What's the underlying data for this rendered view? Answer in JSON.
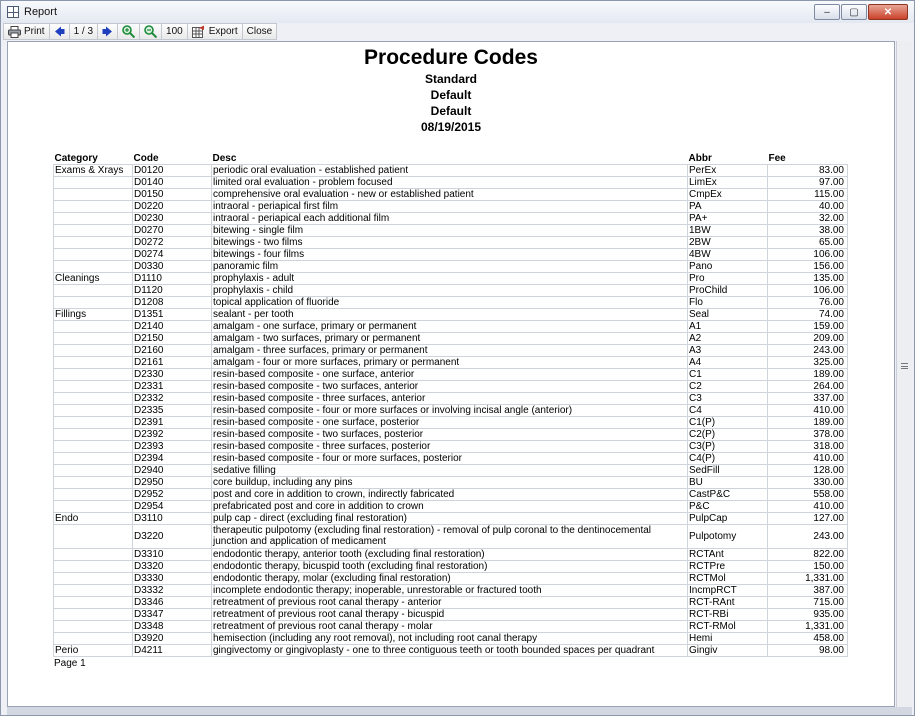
{
  "window": {
    "title": "Report",
    "min_glyph": "–",
    "max_glyph": "▢",
    "close_glyph": "✕"
  },
  "toolbar": {
    "print_label": "Print",
    "page_indicator": "1 / 3",
    "zoom_value": "100",
    "export_label": "Export",
    "close_label": "Close"
  },
  "report": {
    "title": "Procedure Codes",
    "subtitles": [
      "Standard",
      "Default",
      "Default",
      "08/19/2015"
    ],
    "columns": {
      "category": "Category",
      "code": "Code",
      "desc": "Desc",
      "abbr": "Abbr",
      "fee": "Fee"
    },
    "rows": [
      {
        "category": "Exams & Xrays",
        "code": "D0120",
        "desc": "periodic oral evaluation - established patient",
        "abbr": "PerEx",
        "fee": "83.00"
      },
      {
        "category": "",
        "code": "D0140",
        "desc": "limited oral evaluation - problem focused",
        "abbr": "LimEx",
        "fee": "97.00"
      },
      {
        "category": "",
        "code": "D0150",
        "desc": "comprehensive oral evaluation - new or established patient",
        "abbr": "CmpEx",
        "fee": "115.00"
      },
      {
        "category": "",
        "code": "D0220",
        "desc": "intraoral - periapical first film",
        "abbr": "PA",
        "fee": "40.00"
      },
      {
        "category": "",
        "code": "D0230",
        "desc": "intraoral - periapical each additional film",
        "abbr": "PA+",
        "fee": "32.00"
      },
      {
        "category": "",
        "code": "D0270",
        "desc": "bitewing - single film",
        "abbr": "1BW",
        "fee": "38.00"
      },
      {
        "category": "",
        "code": "D0272",
        "desc": "bitewings - two films",
        "abbr": "2BW",
        "fee": "65.00"
      },
      {
        "category": "",
        "code": "D0274",
        "desc": "bitewings - four films",
        "abbr": "4BW",
        "fee": "106.00"
      },
      {
        "category": "",
        "code": "D0330",
        "desc": "panoramic film",
        "abbr": "Pano",
        "fee": "156.00"
      },
      {
        "category": "Cleanings",
        "code": "D1110",
        "desc": "prophylaxis - adult",
        "abbr": "Pro",
        "fee": "135.00"
      },
      {
        "category": "",
        "code": "D1120",
        "desc": "prophylaxis - child",
        "abbr": "ProChild",
        "fee": "106.00"
      },
      {
        "category": "",
        "code": "D1208",
        "desc": "topical application of fluoride",
        "abbr": "Flo",
        "fee": "76.00"
      },
      {
        "category": "Fillings",
        "code": "D1351",
        "desc": "sealant - per tooth",
        "abbr": "Seal",
        "fee": "74.00"
      },
      {
        "category": "",
        "code": "D2140",
        "desc": "amalgam - one surface, primary or permanent",
        "abbr": "A1",
        "fee": "159.00"
      },
      {
        "category": "",
        "code": "D2150",
        "desc": "amalgam - two surfaces, primary or permanent",
        "abbr": "A2",
        "fee": "209.00"
      },
      {
        "category": "",
        "code": "D2160",
        "desc": "amalgam - three surfaces, primary or permanent",
        "abbr": "A3",
        "fee": "243.00"
      },
      {
        "category": "",
        "code": "D2161",
        "desc": "amalgam - four or more surfaces, primary or permanent",
        "abbr": "A4",
        "fee": "325.00"
      },
      {
        "category": "",
        "code": "D2330",
        "desc": "resin-based composite - one surface, anterior",
        "abbr": "C1",
        "fee": "189.00"
      },
      {
        "category": "",
        "code": "D2331",
        "desc": "resin-based composite - two surfaces, anterior",
        "abbr": "C2",
        "fee": "264.00"
      },
      {
        "category": "",
        "code": "D2332",
        "desc": "resin-based composite - three surfaces, anterior",
        "abbr": "C3",
        "fee": "337.00"
      },
      {
        "category": "",
        "code": "D2335",
        "desc": "resin-based composite - four or more surfaces or involving incisal angle (anterior)",
        "abbr": "C4",
        "fee": "410.00"
      },
      {
        "category": "",
        "code": "D2391",
        "desc": "resin-based composite - one surface, posterior",
        "abbr": "C1(P)",
        "fee": "189.00"
      },
      {
        "category": "",
        "code": "D2392",
        "desc": "resin-based composite - two surfaces, posterior",
        "abbr": "C2(P)",
        "fee": "378.00"
      },
      {
        "category": "",
        "code": "D2393",
        "desc": "resin-based composite - three surfaces, posterior",
        "abbr": "C3(P)",
        "fee": "318.00"
      },
      {
        "category": "",
        "code": "D2394",
        "desc": "resin-based composite - four or more surfaces, posterior",
        "abbr": "C4(P)",
        "fee": "410.00"
      },
      {
        "category": "",
        "code": "D2940",
        "desc": "sedative filling",
        "abbr": "SedFill",
        "fee": "128.00"
      },
      {
        "category": "",
        "code": "D2950",
        "desc": "core buildup, including any pins",
        "abbr": "BU",
        "fee": "330.00"
      },
      {
        "category": "",
        "code": "D2952",
        "desc": "post and core in addition to crown, indirectly fabricated",
        "abbr": "CastP&C",
        "fee": "558.00"
      },
      {
        "category": "",
        "code": "D2954",
        "desc": "prefabricated post and core in addition to crown",
        "abbr": "P&C",
        "fee": "410.00"
      },
      {
        "category": "Endo",
        "code": "D3110",
        "desc": "pulp cap - direct (excluding final restoration)",
        "abbr": "PulpCap",
        "fee": "127.00"
      },
      {
        "category": "",
        "code": "D3220",
        "desc": "therapeutic pulpotomy (excluding final restoration) - removal of pulp coronal to the dentinocemental junction and application of medicament",
        "abbr": "Pulpotomy",
        "fee": "243.00",
        "tall": true
      },
      {
        "category": "",
        "code": "D3310",
        "desc": "endodontic therapy, anterior tooth (excluding final restoration)",
        "abbr": "RCTAnt",
        "fee": "822.00"
      },
      {
        "category": "",
        "code": "D3320",
        "desc": "endodontic therapy, bicuspid tooth (excluding final restoration)",
        "abbr": "RCTPre",
        "fee": "150.00"
      },
      {
        "category": "",
        "code": "D3330",
        "desc": "endodontic therapy, molar (excluding final restoration)",
        "abbr": "RCTMol",
        "fee": "1,331.00"
      },
      {
        "category": "",
        "code": "D3332",
        "desc": "incomplete endodontic therapy; inoperable, unrestorable or fractured tooth",
        "abbr": "IncmpRCT",
        "fee": "387.00"
      },
      {
        "category": "",
        "code": "D3346",
        "desc": "retreatment of previous root canal therapy - anterior",
        "abbr": "RCT-RAnt",
        "fee": "715.00"
      },
      {
        "category": "",
        "code": "D3347",
        "desc": "retreatment of previous root canal therapy - bicuspid",
        "abbr": "RCT-RBi",
        "fee": "935.00"
      },
      {
        "category": "",
        "code": "D3348",
        "desc": "retreatment of previous root canal therapy - molar",
        "abbr": "RCT-RMol",
        "fee": "1,331.00"
      },
      {
        "category": "",
        "code": "D3920",
        "desc": "hemisection (including any root removal), not including root canal therapy",
        "abbr": "Hemi",
        "fee": "458.00"
      },
      {
        "category": "Perio",
        "code": "D4211",
        "desc": "gingivectomy or gingivoplasty - one to three contiguous teeth or tooth bounded spaces per quadrant",
        "abbr": "Gingiv",
        "fee": "98.00"
      }
    ],
    "page_label": "Page 1"
  },
  "icons": {
    "print": "printer-icon",
    "prev": "arrow-left-icon",
    "next": "arrow-right-icon",
    "zoom_in": "zoom-in-icon",
    "zoom_out": "zoom-out-icon",
    "export": "export-icon"
  },
  "colors": {
    "arrow": "#1f3fbf",
    "zoom": "#1d8a3a",
    "export_accent": "#c0392b"
  }
}
